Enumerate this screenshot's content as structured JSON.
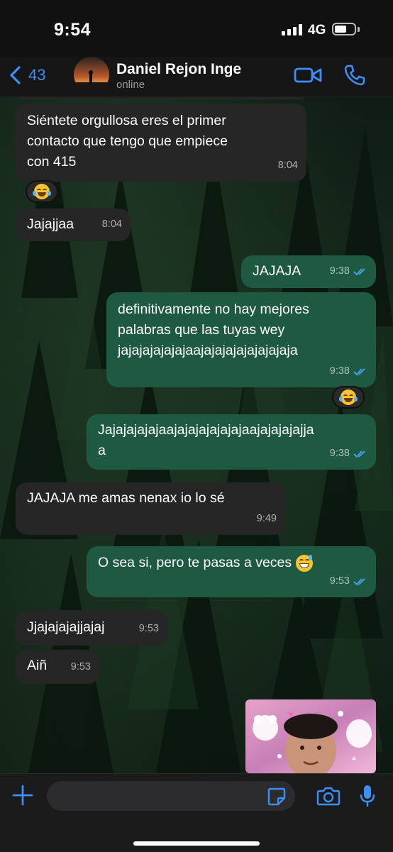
{
  "status_bar": {
    "time": "9:54",
    "network": "4G"
  },
  "header": {
    "back_count": "43",
    "contact_name": "Daniel Rejon Inge",
    "contact_status": "online"
  },
  "messages": [
    {
      "direction": "in",
      "text": "Siéntete orgullosa eres el primer\ncontacto que tengo que empiece\ncon 415",
      "time": "8:04",
      "reaction": "laughing-emoji"
    },
    {
      "direction": "in",
      "text": "Jajajjaa",
      "time": "8:04"
    },
    {
      "direction": "out",
      "text": "JAJAJA",
      "time": "9:38",
      "read": true
    },
    {
      "direction": "out",
      "text": "definitivamente no hay mejores\npalabras que las tuyas wey\njajajajajajajaajajajajajajajajaja",
      "time": "9:38",
      "read": true,
      "reaction": "laughing-emoji"
    },
    {
      "direction": "out",
      "text": "Jajajajajajaajajajajajajajaajajajajajja\na",
      "time": "9:38",
      "read": true
    },
    {
      "direction": "in",
      "text": "JAJAJA me amas nenax io lo sé",
      "time": "9:49"
    },
    {
      "direction": "out",
      "text": "O sea si, pero te pasas a veces ",
      "emoji": "grinning-sweat-emoji",
      "time": "9:53",
      "read": true
    },
    {
      "direction": "in",
      "text": "Jjajajajajjajaj",
      "time": "9:53"
    },
    {
      "direction": "in",
      "text": "Aiñ",
      "time": "9:53"
    }
  ],
  "sticker": {
    "type": "photo-sticker"
  },
  "colors": {
    "accent": "#3d8ef7",
    "incoming_bubble": "#262626",
    "outgoing_bubble": "#1e5a42",
    "read_ticks": "#4aa3f5"
  },
  "composer": {
    "icons": [
      "plus-icon",
      "sticker-icon",
      "camera-icon",
      "microphone-icon"
    ]
  }
}
